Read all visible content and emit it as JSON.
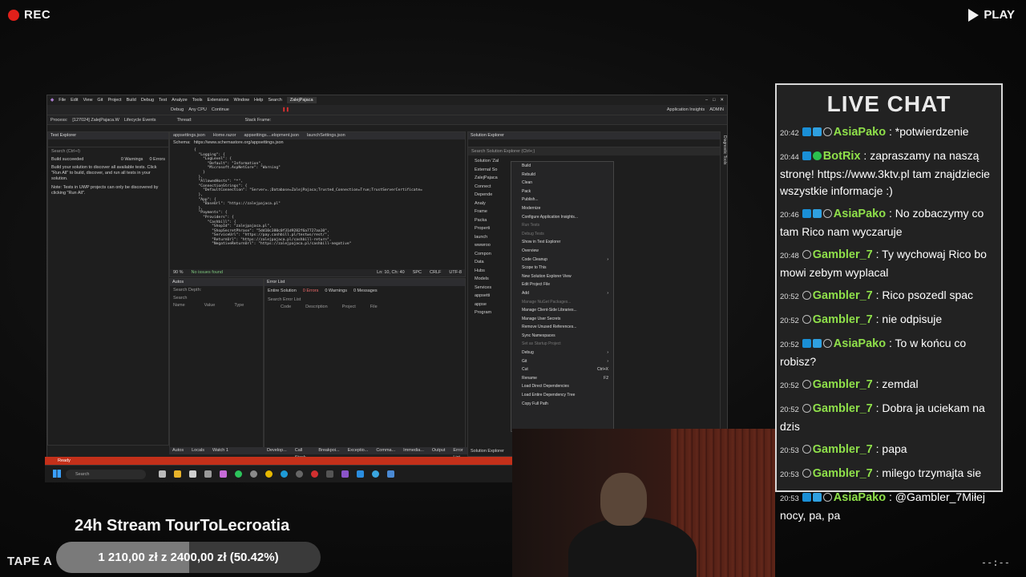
{
  "overlay": {
    "rec_label": "REC",
    "play_label": "PLAY",
    "tape_label": "TAPE A",
    "timecode": "--:--"
  },
  "ide": {
    "menu": [
      "File",
      "Edit",
      "View",
      "Git",
      "Project",
      "Build",
      "Debug",
      "Test",
      "Analyze",
      "Tools",
      "Extensions",
      "Window",
      "Help"
    ],
    "search_label": "Search",
    "solution_title": "ZalejPajaca",
    "admin_label": "ADMIN",
    "app_insights": "Application Insights",
    "debug_config": "Debug",
    "platform": "Any CPU",
    "continue_label": "Continue",
    "process_label": "Process:",
    "process_value": "[127024] ZalejPajaca.W",
    "lifecycle_label": "Lifecycle Events",
    "thread_label": "Thread:",
    "stack_frame_label": "Stack Frame:",
    "test_explorer_title": "Test Explorer",
    "test_search_placeholder": "Search (Ctrl+I)",
    "build_status": "Build succeeded",
    "warnings_label": "0 Warnings",
    "errors_label": "0 Errors",
    "test_help_text": "Build your solution to discover all available tests. Click \"Run All\" to build, discover, and run all tests in your solution.",
    "test_note_text": "Note: Tests in UWP projects can only be discovered by clicking \"Run All\".",
    "editor_tabs": [
      "appsettings.json",
      "Home.razor",
      "appsettings....elopment.json",
      "launchSettings.json"
    ],
    "schema_label": "Schema:",
    "schema_url": "https://www.schemastore.org/appsettings.json",
    "code_lines": [
      "{",
      "  \"Logging\": {",
      "    \"LogLevel\": {",
      "      \"Default\": \"Information\",",
      "      \"Microsoft.AspNetCore\": \"Warning\"",
      "    }",
      "  },",
      "  \"AllowedHosts\": \"*\",",
      "  \"ConnectionStrings\": {",
      "    \"DefaultConnection\": \"Server=.;Database=ZalejPajaca;Trusted_Connection=True;TrustServerCertificate=",
      "  },",
      "  \"App\": {",
      "    \"BaseUrl\": \"https://zalejpajaca.pl\"",
      "  },",
      "  \"Payments\": {",
      "    \"Providers\": {",
      "      \"Cashbill\": {",
      "        \"ShopId\": \"zalejpajaca.pl\",",
      "        \"ShopSecretPhrase\": \"5dd10c380c0f31d9282f6a7727aa10\",",
      "        \"ServiceUrl\": \"https://pay.cashbill.pl/testws/rest/\",",
      "        \"ReturnUrl\": \"https://zalejpajaca.pl/cashbill-return\",",
      "        \"NegativeReturnUrl\": \"https://zalejpajaca.pl/cashbill-negative\""
    ],
    "zoom": "90 %",
    "no_issues": "No issues found",
    "cursor_pos": "Ln: 10, Ch: 40",
    "spc": "SPC",
    "crlf": "CRLF",
    "encoding": "UTF-8",
    "autos_title": "Autos",
    "search_depth": "Search Depth:",
    "autos_search": "Search",
    "autos_columns": [
      "Name",
      "Value",
      "Type"
    ],
    "error_list_title": "Error List",
    "error_scope": "Entire Solution",
    "error_errors": "0 Errors",
    "error_warnings": "0 Warnings",
    "error_messages": "0 Messages",
    "error_search": "Search Error List",
    "error_columns": [
      "Code",
      "Description",
      "Project",
      "File"
    ],
    "bottom_tabs_left": [
      "Autos",
      "Locals",
      "Watch 1"
    ],
    "bottom_tabs_right": [
      "Develop...",
      "Call Stack",
      "Breakpoi...",
      "Exceptio...",
      "Comma...",
      "Immedia...",
      "Output",
      "Error List"
    ],
    "solution_explorer_title": "Solution Explorer",
    "solution_search": "Search Solution Explorer (Ctrl+;)",
    "solution_tree": [
      "Solution 'Zal",
      "External So",
      "ZalejPajaca",
      "Connect",
      "Depende",
      "Analy",
      "Frame",
      "Packa",
      "Properti",
      "launch",
      "wwwroo",
      "Compon",
      "Data",
      "Hubs",
      "Models",
      "Services",
      "appsetti",
      "appse",
      "Program"
    ],
    "solution_tab": "Solution Explorer",
    "diagnostic_tab": "Diagnostic Tools",
    "status_ready": "Ready",
    "context_menu": [
      {
        "label": "Build"
      },
      {
        "label": "Rebuild"
      },
      {
        "label": "Clean"
      },
      {
        "label": "Pack"
      },
      {
        "label": "Publish..."
      },
      {
        "label": "Modernize"
      },
      {
        "label": "Configure Application Insights..."
      },
      {
        "label": "Run Tests",
        "dim": true
      },
      {
        "label": "Debug Tests",
        "dim": true
      },
      {
        "label": "Show in Test Explorer"
      },
      {
        "label": "Overview"
      },
      {
        "label": "Code Cleanup",
        "arrow": true
      },
      {
        "label": "Scope to This"
      },
      {
        "label": "New Solution Explorer View"
      },
      {
        "label": "Edit Project File"
      },
      {
        "label": "Add",
        "arrow": true
      },
      {
        "label": "Manage NuGet Packages...",
        "dim": true
      },
      {
        "label": "Manage Client-Side Libraries..."
      },
      {
        "label": "Manage User Secrets"
      },
      {
        "label": "Remove Unused References..."
      },
      {
        "label": "Sync Namespaces"
      },
      {
        "label": "Set as Startup Project",
        "dim": true
      },
      {
        "label": "Debug",
        "arrow": true
      },
      {
        "label": "Git",
        "arrow": true
      },
      {
        "label": "Cut",
        "shortcut": "Ctrl+X"
      },
      {
        "label": "Rename",
        "shortcut": "F2"
      },
      {
        "label": "Load Direct Dependencies"
      },
      {
        "label": "Load Entire Dependency Tree"
      },
      {
        "label": "Copy Full Path"
      }
    ]
  },
  "taskbar": {
    "search_label": "Search"
  },
  "chat": {
    "title": "LIVE CHAT",
    "messages": [
      {
        "time": "20:42",
        "badges": [
          "b-blue",
          "b-cube",
          "b-gray"
        ],
        "nick": "AsiaPako",
        "text": "*potwierdzenie"
      },
      {
        "time": "20:44",
        "badges": [
          "b-blue",
          "b-check"
        ],
        "nick": "BotRix",
        "text": "zapraszamy na naszą stronę! https://www.3ktv.pl tam znajdziecie wszystkie informacje :)"
      },
      {
        "time": "20:46",
        "badges": [
          "b-blue",
          "b-cube",
          "b-gray"
        ],
        "nick": "AsiaPako",
        "text": "No zobaczymy co tam Rico nam wyczaruje"
      },
      {
        "time": "20:48",
        "badges": [
          "b-gray"
        ],
        "nick": "Gambler_7",
        "text": "Ty wychowaj Rico bo mowi zebym wyplacal"
      },
      {
        "time": "20:52",
        "badges": [
          "b-gray"
        ],
        "nick": "Gambler_7",
        "text": "Rico psozedl spac"
      },
      {
        "time": "20:52",
        "badges": [
          "b-gray"
        ],
        "nick": "Gambler_7",
        "text": "nie odpisuje"
      },
      {
        "time": "20:52",
        "badges": [
          "b-blue",
          "b-cube",
          "b-gray"
        ],
        "nick": "AsiaPako",
        "text": "To w końcu co robisz?"
      },
      {
        "time": "20:52",
        "badges": [
          "b-gray"
        ],
        "nick": "Gambler_7",
        "text": "zemdal"
      },
      {
        "time": "20:52",
        "badges": [
          "b-gray"
        ],
        "nick": "Gambler_7",
        "text": "Dobra ja uciekam na dzis"
      },
      {
        "time": "20:53",
        "badges": [
          "b-gray"
        ],
        "nick": "Gambler_7",
        "text": "papa"
      },
      {
        "time": "20:53",
        "badges": [
          "b-gray"
        ],
        "nick": "Gambler_7",
        "text": "milego trzymajta sie"
      },
      {
        "time": "20:53",
        "badges": [
          "b-blue",
          "b-cube",
          "b-gray"
        ],
        "nick": "AsiaPako",
        "text": "@Gambler_7Miłej nocy, pa, pa"
      }
    ]
  },
  "stream": {
    "title": "24h Stream TourToLecroatia",
    "progress_text": "1 210,00 zł  z  2400,00 zł  (50.42%)",
    "progress_fraction": 0.5042
  }
}
